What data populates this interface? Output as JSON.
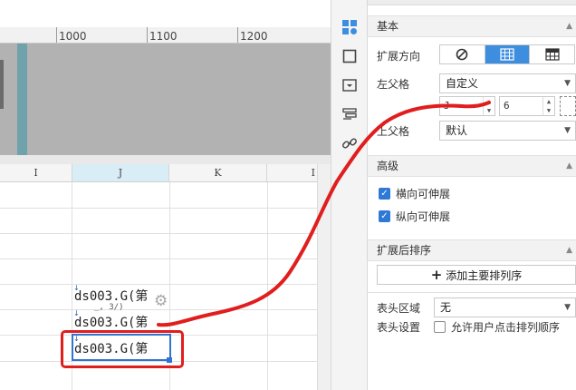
{
  "ruler": {
    "ticks": [
      "1000",
      "1100",
      "1200"
    ]
  },
  "grid": {
    "columns": [
      "I",
      "J",
      "K",
      "I"
    ],
    "selected_column": "J",
    "cells": [
      {
        "text": "ds003.G(第",
        "sub": "_, 3/)"
      },
      {
        "text": "ds003.G(第"
      },
      {
        "text": "ds003.G(第"
      }
    ]
  },
  "side_icons": [
    "cell-element-icon",
    "border-icon",
    "dropdown-widget-icon",
    "form-icon",
    "link-icon"
  ],
  "panel": {
    "basic": {
      "title": "基本",
      "expand_direction_label": "扩展方向",
      "expand_options": [
        "no-expand-icon",
        "horizontal-expand-icon",
        "vertical-expand-icon"
      ],
      "active_option": 1,
      "left_parent_label": "左父格",
      "left_parent_value": "自定义",
      "left_parent_col": "J",
      "left_parent_row": "6",
      "top_parent_label": "上父格",
      "top_parent_value": "默认"
    },
    "advanced": {
      "title": "高级",
      "h_extendable": "横向可伸展",
      "v_extendable": "纵向可伸展",
      "h_checked": true,
      "v_checked": true
    },
    "sort": {
      "title": "扩展后排序",
      "add_button": "添加主要排列序"
    },
    "header": {
      "area_label": "表头区域",
      "area_value": "无",
      "settings_label": "表头设置",
      "allow_sort_label": "允许用户点击排列顺序",
      "allow_sort_checked": false
    }
  },
  "colors": {
    "accent": "#3e8ee0",
    "annotation": "#e01e1e",
    "preview_bg": "#b2b2b2",
    "teal": "#6fa2aa"
  }
}
